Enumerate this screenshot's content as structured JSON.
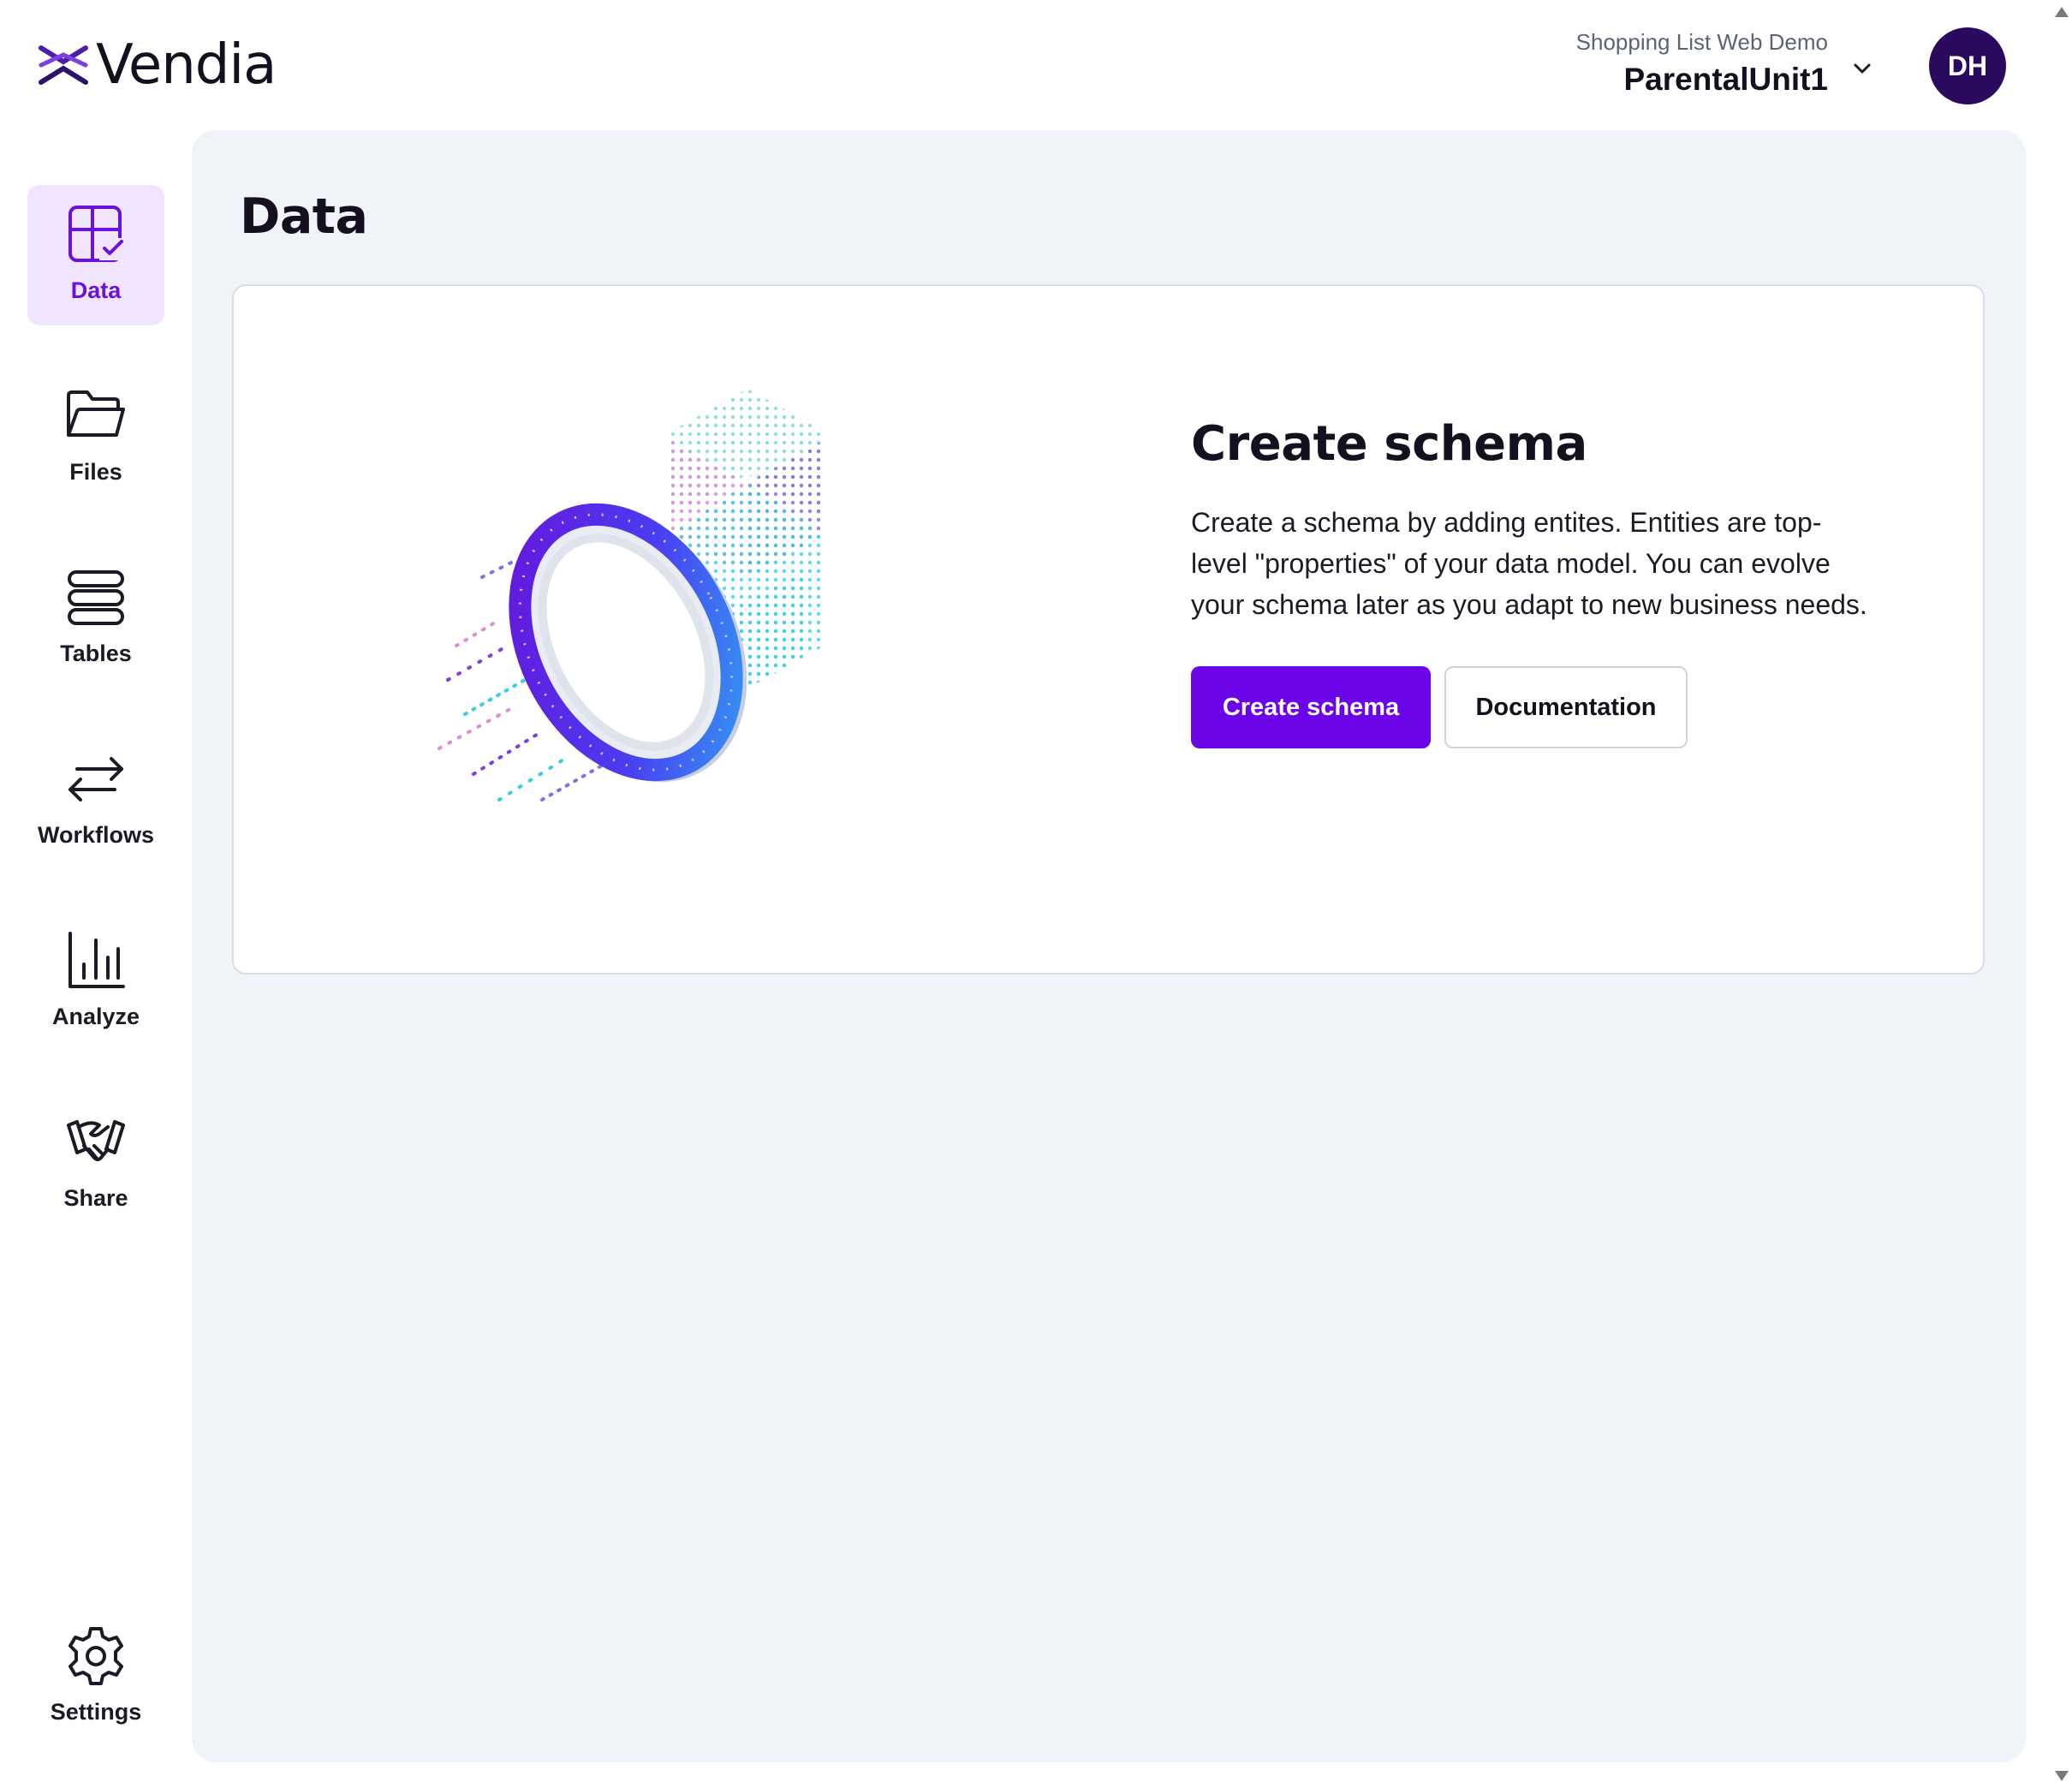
{
  "header": {
    "logo_text": "Vendia",
    "account_subtitle": "Shopping List Web Demo",
    "account_name": "ParentalUnit1",
    "avatar_initials": "DH"
  },
  "sidebar": {
    "items": [
      {
        "label": "Data",
        "icon": "data-grid-icon",
        "active": true
      },
      {
        "label": "Files",
        "icon": "folder-icon",
        "active": false
      },
      {
        "label": "Tables",
        "icon": "tables-icon",
        "active": false
      },
      {
        "label": "Workflows",
        "icon": "workflows-icon",
        "active": false
      },
      {
        "label": "Analyze",
        "icon": "bar-chart-icon",
        "active": false
      },
      {
        "label": "Share",
        "icon": "handshake-icon",
        "active": false
      }
    ],
    "settings_label": "Settings"
  },
  "main": {
    "page_title": "Data",
    "cta": {
      "title": "Create schema",
      "description": "Create a schema by adding entites. Entities are top-level \"properties\" of your data model. You can evolve your schema later as you adapt to new business needs.",
      "primary_button": "Create schema",
      "secondary_button": "Documentation"
    }
  },
  "colors": {
    "accent": "#6b05e8",
    "active_nav_bg": "#f1e4fd",
    "active_nav_text": "#6a12d9",
    "panel_bg": "#f0f3f8",
    "avatar_bg": "#2a0a5e"
  }
}
